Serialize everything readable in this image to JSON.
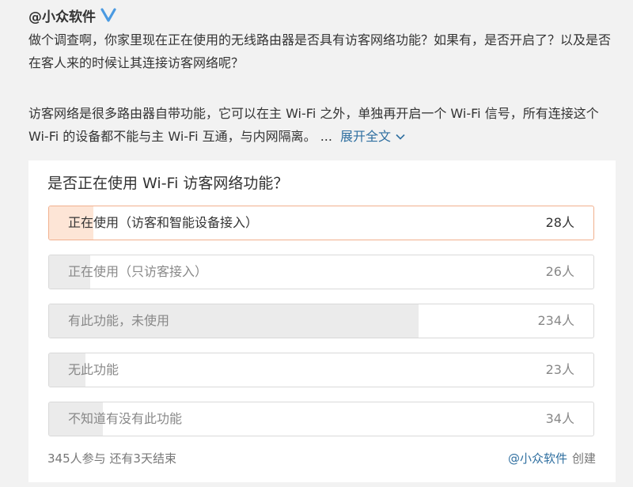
{
  "post": {
    "author": "@小众软件",
    "paragraph1": "做个调查啊，你家里现在正在使用的无线路由器是否具有访客网络功能？如果有，是否开启了？以及是否在客人来的时候让其连接访客网络呢？",
    "paragraph2": "访客网络是很多路由器自带功能，它可以在主 Wi-Fi 之外，单独再开启一个 Wi-Fi 信号，所有连接这个 Wi-Fi 的设备都不能与主 Wi-Fi 互通，与内网隔离。 ...",
    "expand_label": "展开全文"
  },
  "poll": {
    "question": "是否正在使用 Wi-Fi 访客网络功能？",
    "total_votes": 345,
    "options": [
      {
        "label": "正在使用（访客和智能设备接入）",
        "count": 28,
        "count_label": "28人",
        "selected": true
      },
      {
        "label": "正在使用（只访客接入）",
        "count": 26,
        "count_label": "26人",
        "selected": false
      },
      {
        "label": "有此功能，未使用",
        "count": 234,
        "count_label": "234人",
        "selected": false
      },
      {
        "label": "无此功能",
        "count": 23,
        "count_label": "23人",
        "selected": false
      },
      {
        "label": "不知道有没有此功能",
        "count": 34,
        "count_label": "34人",
        "selected": false
      }
    ],
    "footer_stats": "345人参与  还有3天结束",
    "creator": "@小众软件",
    "creator_suffix": "创建"
  },
  "colors": {
    "verified": "#4a9ae1",
    "link": "#2f6fa0",
    "selected_fill": "#fde5d6",
    "selected_border": "#f1b08e",
    "bar_fill": "#ebebeb"
  },
  "icons": {
    "verified": "verified-v-icon",
    "expand": "chevron-down-icon"
  }
}
